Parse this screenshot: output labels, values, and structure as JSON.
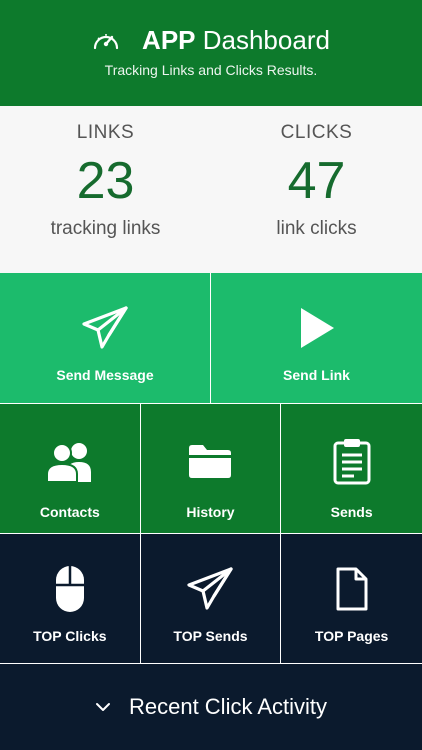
{
  "header": {
    "title_bold": "APP",
    "title_rest": " Dashboard",
    "subtitle": "Tracking Links and Clicks Results.",
    "icon": "gauge-icon"
  },
  "stats": {
    "links": {
      "label": "LINKS",
      "value": "23",
      "desc": "tracking links"
    },
    "clicks": {
      "label": "CLICKS",
      "value": "47",
      "desc": "link clicks"
    }
  },
  "tiles": {
    "send_message": {
      "label": "Send Message",
      "icon": "paper-plane-icon"
    },
    "send_link": {
      "label": "Send Link",
      "icon": "play-icon"
    },
    "contacts": {
      "label": "Contacts",
      "icon": "users-icon"
    },
    "history": {
      "label": "History",
      "icon": "folder-icon"
    },
    "sends": {
      "label": "Sends",
      "icon": "clipboard-icon"
    },
    "top_clicks": {
      "label": "TOP Clicks",
      "icon": "mouse-icon"
    },
    "top_sends": {
      "label": "TOP Sends",
      "icon": "paper-plane-icon"
    },
    "top_pages": {
      "label": "TOP Pages",
      "icon": "file-icon"
    }
  },
  "recent": {
    "label": "Recent Click Activity",
    "icon": "chevron-down-icon"
  },
  "colors": {
    "header_green": "#0d7a2c",
    "light_green": "#1cbb6c",
    "dark_green": "#0d7a2c",
    "navy": "#0b1a2d",
    "stat_value": "#166b2e"
  }
}
